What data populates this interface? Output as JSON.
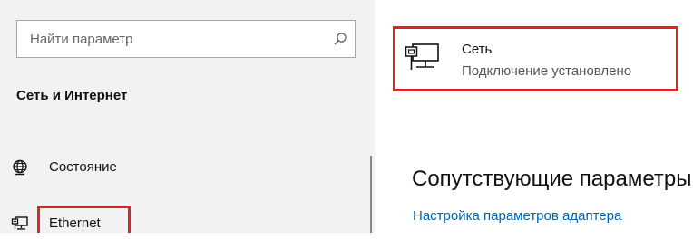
{
  "search": {
    "placeholder": "Найти параметр",
    "icon": "search-icon"
  },
  "sidebar": {
    "section_title": "Сеть и Интернет",
    "items": [
      {
        "label": "Состояние",
        "icon": "globe-icon"
      },
      {
        "label": "Ethernet",
        "icon": "ethernet-icon"
      }
    ]
  },
  "network": {
    "name": "Сеть",
    "status": "Подключение установлено",
    "icon": "ethernet-monitor-icon"
  },
  "related": {
    "heading": "Сопутствующие параметры",
    "adapter_link": "Настройка параметров адаптера"
  },
  "colors": {
    "highlight": "#d62828",
    "link": "#0063b1",
    "sidebar_bg": "#f2f2f2"
  }
}
